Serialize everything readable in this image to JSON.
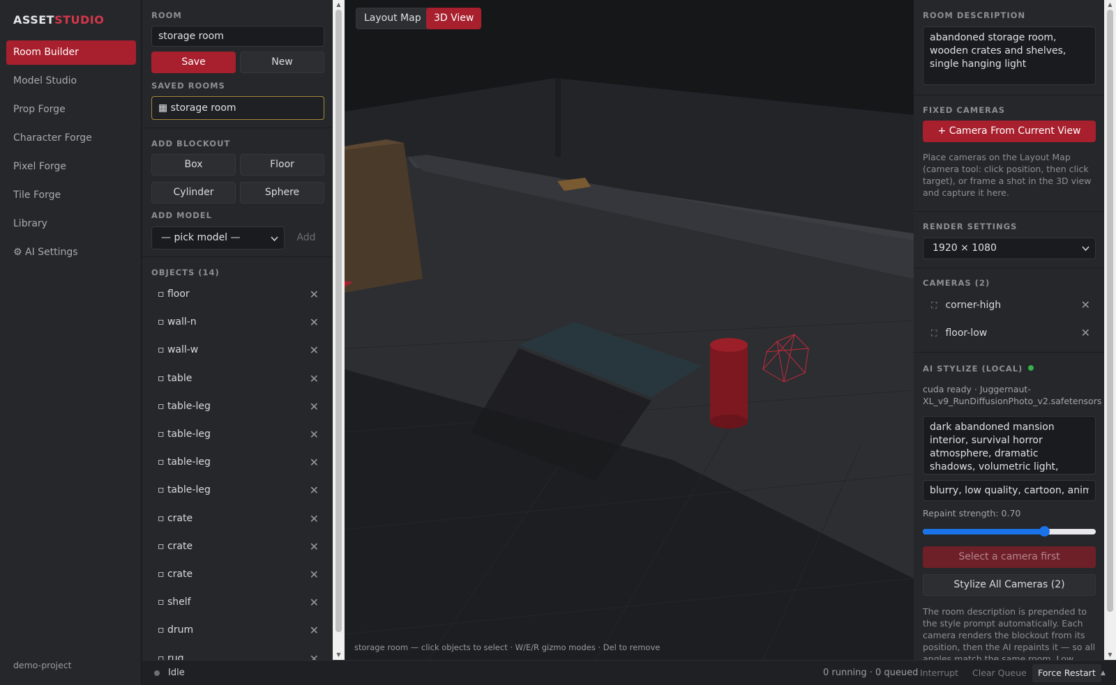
{
  "app": {
    "logo_primary": "ASSET",
    "logo_accent": "STUDIO",
    "project": "demo-project"
  },
  "nav": {
    "items": [
      {
        "label": "Room Builder"
      },
      {
        "label": "Model Studio"
      },
      {
        "label": "Prop Forge"
      },
      {
        "label": "Character Forge"
      },
      {
        "label": "Pixel Forge"
      },
      {
        "label": "Tile Forge"
      },
      {
        "label": "Library"
      },
      {
        "label": "⚙ AI Settings"
      }
    ]
  },
  "room": {
    "label": "ROOM",
    "name": "storage room",
    "save": "Save",
    "new": "New",
    "saved_label": "SAVED ROOMS",
    "saved_item": "▦ storage room"
  },
  "blockout": {
    "label": "ADD BLOCKOUT",
    "box": "Box",
    "floor": "Floor",
    "cylinder": "Cylinder",
    "sphere": "Sphere"
  },
  "model": {
    "label": "ADD MODEL",
    "select": "— pick model —",
    "add": "Add"
  },
  "objects": {
    "label": "OBJECTS (14)",
    "items": [
      {
        "name": "▫ floor"
      },
      {
        "name": "▫ wall-n"
      },
      {
        "name": "▫ wall-w"
      },
      {
        "name": "▫ table"
      },
      {
        "name": "▫ table-leg"
      },
      {
        "name": "▫ table-leg"
      },
      {
        "name": "▫ table-leg"
      },
      {
        "name": "▫ table-leg"
      },
      {
        "name": "▫ crate"
      },
      {
        "name": "▫ crate"
      },
      {
        "name": "▫ crate"
      },
      {
        "name": "▫ shelf"
      },
      {
        "name": "▫ drum"
      },
      {
        "name": "▫ rug"
      }
    ],
    "remove_glyph": "✕"
  },
  "viewport": {
    "tab_layout": "Layout Map",
    "tab_3d": "3D View",
    "hint": "storage room — click objects to select · W/E/R gizmo modes · Del to remove"
  },
  "right": {
    "desc_label": "ROOM DESCRIPTION",
    "desc_text": "abandoned storage room, wooden crates and shelves, single hanging light",
    "fixed_label": "FIXED CAMERAS",
    "camera_btn": "+ Camera From Current View",
    "fixed_help": "Place cameras on the Layout Map (camera tool: click position, then click target), or frame a shot in the 3D view and capture it here.",
    "render_label": "RENDER SETTINGS",
    "resolution": "1920 × 1080",
    "cameras_label": "CAMERAS (2)",
    "cameras": [
      {
        "name": "corner-high"
      },
      {
        "name": "floor-low"
      }
    ],
    "ai_label": "AI STYLIZE (LOCAL)",
    "ai_status": "cuda ready · Juggernaut-XL_v9_RunDiffusionPhoto_v2.safetensors",
    "style_prompt": "dark abandoned mansion interior, survival horror atmosphere, dramatic shadows, volumetric light, decayed wood and dust,",
    "negative_prompt": "blurry, low quality, cartoon, anime, fla",
    "strength_label": "Repaint strength: 0.70",
    "strength_value": 0.7,
    "select_cam_btn": "Select a camera first",
    "stylize_all_btn": "Stylize All Cameras (2)",
    "footer_help": "The room description is prepended to the style prompt automatically. Each camera renders the blockout from its position, then the AI repaints it — so all angles match the same room. Low strength keeps"
  },
  "status": {
    "state": "Idle",
    "queue": "0 running · 0 queued",
    "interrupt": "Interrupt",
    "clear": "Clear Queue",
    "restart": "Force Restart",
    "caret": "▲"
  },
  "colors": {
    "accent": "#a8202e",
    "brand": "#d3374b",
    "panel": "#26272b",
    "viewport_bg": "#161719"
  }
}
